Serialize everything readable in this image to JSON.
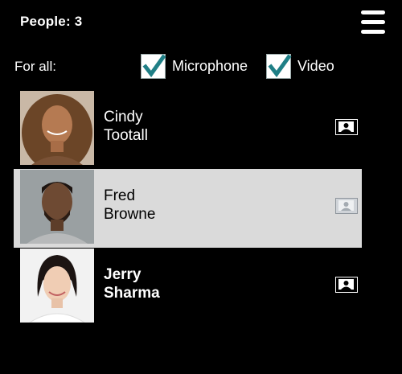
{
  "header": {
    "people_count": "People: 3",
    "menu_icon": "hamburger-menu-icon"
  },
  "controls": {
    "for_all_label": "For all:",
    "microphone": {
      "label": "Microphone",
      "checked": true
    },
    "video": {
      "label": "Video",
      "checked": true
    }
  },
  "participants": [
    {
      "first": "Cindy",
      "last": "Tootall",
      "selected": false,
      "bold": false,
      "pin_icon": "pin-video-icon"
    },
    {
      "first": "Fred",
      "last": "Browne",
      "selected": true,
      "bold": false,
      "pin_icon": "pin-video-icon"
    },
    {
      "first": "Jerry",
      "last": "Sharma",
      "selected": false,
      "bold": true,
      "pin_icon": "pin-video-icon"
    }
  ],
  "colors": {
    "background": "#000000",
    "selected_row": "#dadada",
    "checkbox_check": "#1f7f86"
  }
}
